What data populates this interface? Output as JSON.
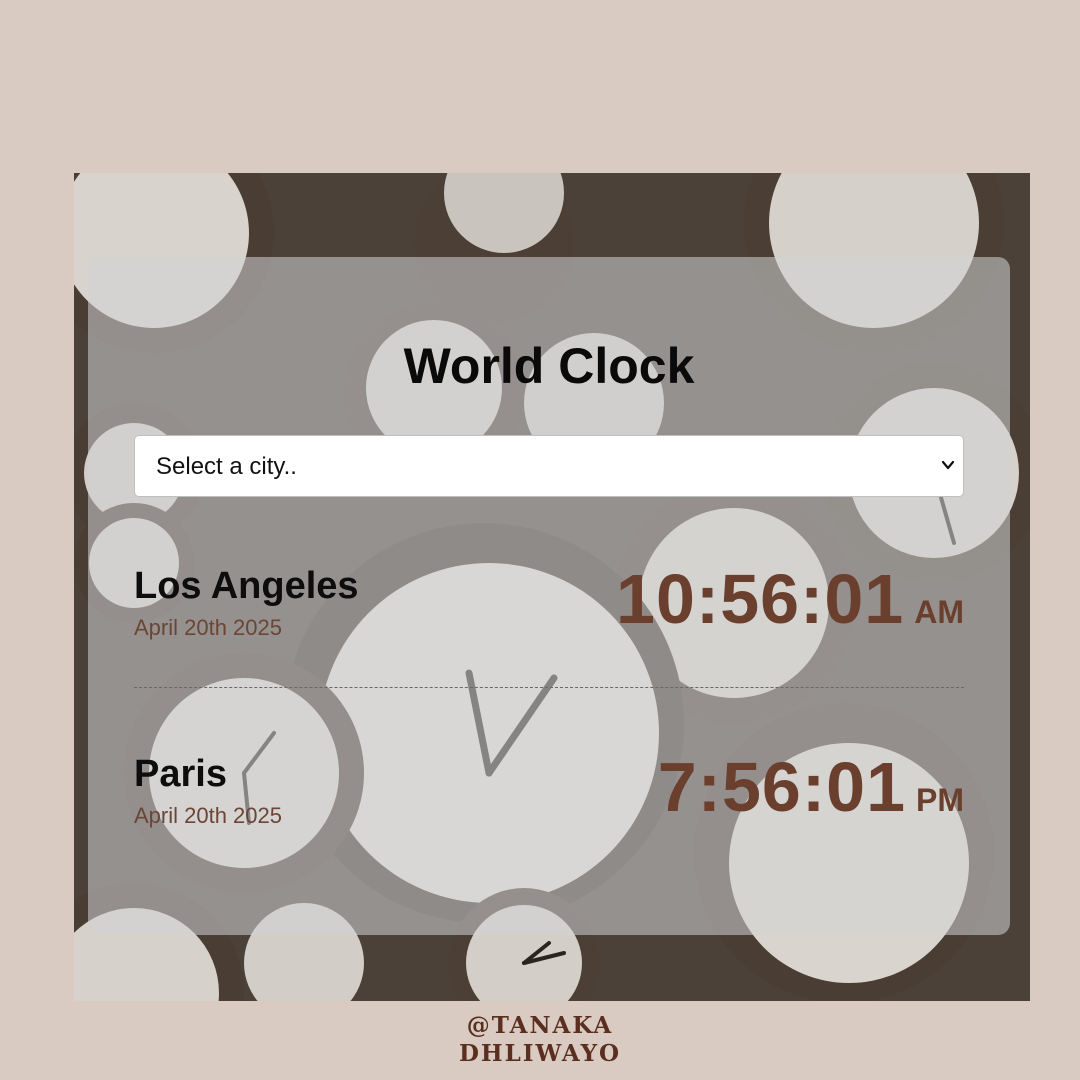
{
  "app": {
    "title": "World Clock"
  },
  "city_select": {
    "selected_label": "Select a city.."
  },
  "cities": [
    {
      "name": "Los Angeles",
      "date": "April 20th 2025",
      "time": "10:56:01",
      "period": "AM"
    },
    {
      "name": "Paris",
      "date": "April 20th 2025",
      "time": "7:56:01",
      "period": "PM"
    }
  ],
  "credit": {
    "line1": "@TANAKA",
    "line2": "DHLIWAYO"
  },
  "colors": {
    "page_background": "#d9cbc1",
    "time_accent": "#6b3f2e",
    "date_accent": "#6b4535",
    "card_overlay": "rgba(210,212,214,0.55)"
  },
  "icons": {
    "select_chevron": "chevron-down-icon",
    "background": "vintage-clocks-image"
  }
}
